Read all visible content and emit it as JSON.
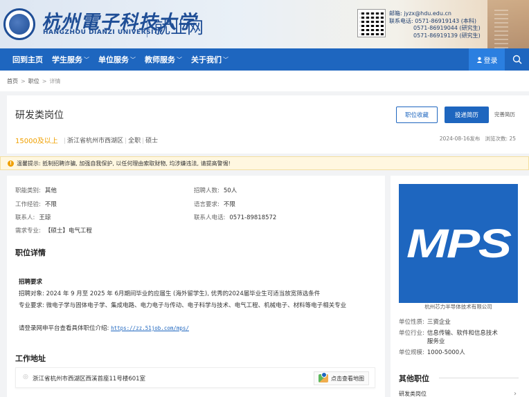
{
  "header": {
    "logo_cn": "杭州電子科技大学",
    "logo_en": "HANGZHOU DIANZI UNIVERSITY",
    "site_name": "就业网",
    "contact": {
      "email": "邮箱: jyzx@hdu.edu.cn",
      "phone1": "联系电话: 0571-86919143 (本科)",
      "phone2": "0571-86919044 (研究生)",
      "phone3": "0571-86919139 (研究生)"
    }
  },
  "nav": {
    "items": [
      {
        "label": "回到主页",
        "has_menu": false
      },
      {
        "label": "学生服务",
        "has_menu": true
      },
      {
        "label": "单位服务",
        "has_menu": true
      },
      {
        "label": "教师服务",
        "has_menu": true
      },
      {
        "label": "关于我们",
        "has_menu": true
      }
    ],
    "login": "登录"
  },
  "breadcrumb": {
    "home": "首页",
    "position": "职位",
    "current": "详情"
  },
  "job": {
    "title": "研发类岗位",
    "salary": "15000及以上",
    "location": "浙江省杭州市西湖区",
    "type": "全职",
    "degree": "硕士",
    "fav_button": "职位收藏",
    "apply_button": "投递简历",
    "perfect_resume": "完善简历",
    "published": "2024-08-16发布",
    "views": "浏览次数: 25"
  },
  "warning": "温馨提示: 抵制招聘诈骗, 加强自我保护, 以任何理由索取财物, 均涉嫌违法, 请提高警惕!",
  "details": {
    "category_label": "职能类别:",
    "category": "其他",
    "headcount_label": "招聘人数:",
    "headcount": "50人",
    "experience_label": "工作经验:",
    "experience": "不限",
    "language_label": "语言要求:",
    "language": "不限",
    "contact_label": "联系人:",
    "contact": "王琼",
    "contact_phone_label": "联系人电话:",
    "contact_phone": "0571-89818572",
    "major_label": "需求专业:",
    "major": "【硕士】电气工程",
    "section_title": "职位详情",
    "req_title": "招聘要求",
    "req_target": "招聘对象: 2024 年 9 月至 2025 年 6月期间毕业的应届生 (海外留学生), 优秀的2024届毕业生可适当放宽筛选条件",
    "req_major": "专业要求: 微电子学与固体电子学、集成电路、电力电子与传动、电子科学与技术、电气工程、机械电子、材料等电子相关专业",
    "link_text": "请登录网申平台查看具体职位介绍:",
    "link_url": "https://zz.51job.com/mps/",
    "address_title": "工作地址",
    "address": "浙江省杭州市西湖区西溪首座11号楼601室",
    "map_button": "点击查看地图"
  },
  "company": {
    "logo_text": "MPS",
    "name": "杭州芯力半导体技术有限公司",
    "nature_label": "单位性质:",
    "nature": "三资企业",
    "industry_label": "单位行业:",
    "industry": "信息传输、软件和信息技术服务业",
    "scale_label": "单位规模:",
    "scale": "1000-5000人",
    "other_title": "其他职位",
    "other_item": "研发类岗位"
  }
}
